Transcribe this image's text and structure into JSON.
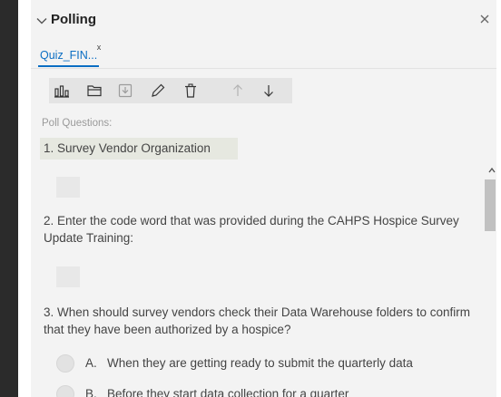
{
  "panel": {
    "title": "Polling",
    "collapse_icon": "chevron-down-icon",
    "close_label": "×"
  },
  "tab": {
    "label": "Quiz_FIN...",
    "dirty_marker": "x"
  },
  "toolbar": {
    "buttons": [
      {
        "icon": "poll-results-icon",
        "enabled": true
      },
      {
        "icon": "open-folder-icon",
        "enabled": true
      },
      {
        "icon": "save-download-icon",
        "enabled": false
      },
      {
        "icon": "edit-pencil-icon",
        "enabled": true
      },
      {
        "icon": "trash-icon",
        "enabled": true
      },
      {
        "icon": "move-up-arrow-icon",
        "enabled": false
      },
      {
        "icon": "move-down-arrow-icon",
        "enabled": true
      }
    ]
  },
  "poll": {
    "section_label": "Poll Questions:",
    "questions": [
      {
        "number": "1.",
        "text": "Survey Vendor Organization"
      },
      {
        "number": "2.",
        "text": "Enter the code word that was provided during the CAHPS Hospice Survey Update Training:"
      },
      {
        "number": "3.",
        "text": "When should survey vendors check their Data Warehouse folders to confirm that they have been authorized by a hospice?",
        "options": [
          {
            "letter": "A.",
            "text": "When they are getting ready to submit the quarterly data"
          },
          {
            "letter": "B.",
            "text": "Before they start data collection for a quarter"
          }
        ]
      }
    ]
  },
  "colors": {
    "accent": "#0b6ec3",
    "panel_bg": "#f3f3f3",
    "left_bar": "#2b2b2b"
  }
}
